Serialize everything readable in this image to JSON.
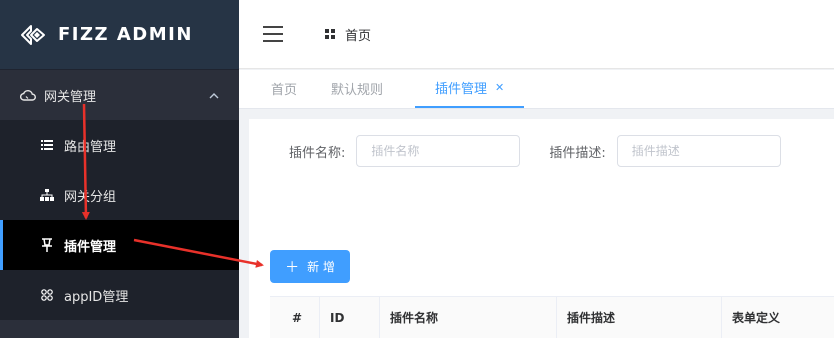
{
  "app": {
    "title": "FIZZ ADMIN"
  },
  "sidebar": {
    "group": {
      "label": "网关管理",
      "icon": "cloud-icon",
      "expanded": true
    },
    "items": [
      {
        "label": "路由管理",
        "icon": "list-icon",
        "active": false
      },
      {
        "label": "网关分组",
        "icon": "sitemap-icon",
        "active": false
      },
      {
        "label": "插件管理",
        "icon": "pin-icon",
        "active": true
      },
      {
        "label": "appID管理",
        "icon": "apps-icon",
        "active": false
      }
    ]
  },
  "header": {
    "breadcrumb": "首页"
  },
  "tabs": [
    {
      "label": "首页",
      "active": false
    },
    {
      "label": "默认规则",
      "active": false
    },
    {
      "label": "插件管理",
      "active": true,
      "closable": true
    }
  ],
  "search": {
    "name_label": "插件名称:",
    "name_placeholder": "插件名称",
    "desc_label": "插件描述:",
    "desc_placeholder": "插件描述"
  },
  "actions": {
    "add_label": "新 增"
  },
  "table": {
    "columns": [
      "#",
      "ID",
      "插件名称",
      "插件描述",
      "表单定义"
    ]
  },
  "colors": {
    "accent": "#409eff",
    "sidebar_bg": "#2b2f3a",
    "arrow": "#e8312a"
  }
}
